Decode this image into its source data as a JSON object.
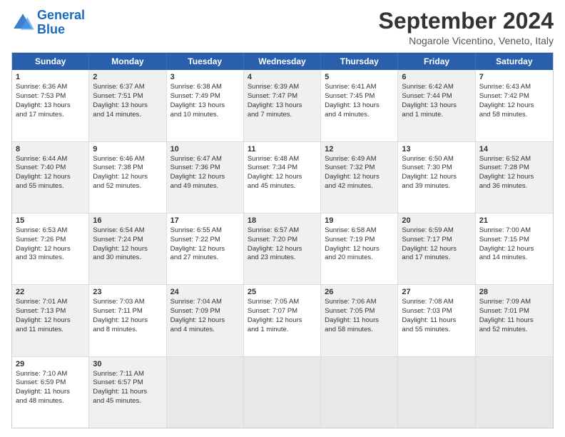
{
  "header": {
    "logo": {
      "line1": "General",
      "line2": "Blue"
    },
    "title": "September 2024",
    "location": "Nogarole Vicentino, Veneto, Italy"
  },
  "days_of_week": [
    "Sunday",
    "Monday",
    "Tuesday",
    "Wednesday",
    "Thursday",
    "Friday",
    "Saturday"
  ],
  "weeks": [
    [
      {
        "day": "1",
        "lines": [
          "Sunrise: 6:36 AM",
          "Sunset: 7:53 PM",
          "Daylight: 13 hours",
          "and 17 minutes."
        ],
        "shaded": false
      },
      {
        "day": "2",
        "lines": [
          "Sunrise: 6:37 AM",
          "Sunset: 7:51 PM",
          "Daylight: 13 hours",
          "and 14 minutes."
        ],
        "shaded": true
      },
      {
        "day": "3",
        "lines": [
          "Sunrise: 6:38 AM",
          "Sunset: 7:49 PM",
          "Daylight: 13 hours",
          "and 10 minutes."
        ],
        "shaded": false
      },
      {
        "day": "4",
        "lines": [
          "Sunrise: 6:39 AM",
          "Sunset: 7:47 PM",
          "Daylight: 13 hours",
          "and 7 minutes."
        ],
        "shaded": true
      },
      {
        "day": "5",
        "lines": [
          "Sunrise: 6:41 AM",
          "Sunset: 7:45 PM",
          "Daylight: 13 hours",
          "and 4 minutes."
        ],
        "shaded": false
      },
      {
        "day": "6",
        "lines": [
          "Sunrise: 6:42 AM",
          "Sunset: 7:44 PM",
          "Daylight: 13 hours",
          "and 1 minute."
        ],
        "shaded": true
      },
      {
        "day": "7",
        "lines": [
          "Sunrise: 6:43 AM",
          "Sunset: 7:42 PM",
          "Daylight: 12 hours",
          "and 58 minutes."
        ],
        "shaded": false
      }
    ],
    [
      {
        "day": "8",
        "lines": [
          "Sunrise: 6:44 AM",
          "Sunset: 7:40 PM",
          "Daylight: 12 hours",
          "and 55 minutes."
        ],
        "shaded": true
      },
      {
        "day": "9",
        "lines": [
          "Sunrise: 6:46 AM",
          "Sunset: 7:38 PM",
          "Daylight: 12 hours",
          "and 52 minutes."
        ],
        "shaded": false
      },
      {
        "day": "10",
        "lines": [
          "Sunrise: 6:47 AM",
          "Sunset: 7:36 PM",
          "Daylight: 12 hours",
          "and 49 minutes."
        ],
        "shaded": true
      },
      {
        "day": "11",
        "lines": [
          "Sunrise: 6:48 AM",
          "Sunset: 7:34 PM",
          "Daylight: 12 hours",
          "and 45 minutes."
        ],
        "shaded": false
      },
      {
        "day": "12",
        "lines": [
          "Sunrise: 6:49 AM",
          "Sunset: 7:32 PM",
          "Daylight: 12 hours",
          "and 42 minutes."
        ],
        "shaded": true
      },
      {
        "day": "13",
        "lines": [
          "Sunrise: 6:50 AM",
          "Sunset: 7:30 PM",
          "Daylight: 12 hours",
          "and 39 minutes."
        ],
        "shaded": false
      },
      {
        "day": "14",
        "lines": [
          "Sunrise: 6:52 AM",
          "Sunset: 7:28 PM",
          "Daylight: 12 hours",
          "and 36 minutes."
        ],
        "shaded": true
      }
    ],
    [
      {
        "day": "15",
        "lines": [
          "Sunrise: 6:53 AM",
          "Sunset: 7:26 PM",
          "Daylight: 12 hours",
          "and 33 minutes."
        ],
        "shaded": false
      },
      {
        "day": "16",
        "lines": [
          "Sunrise: 6:54 AM",
          "Sunset: 7:24 PM",
          "Daylight: 12 hours",
          "and 30 minutes."
        ],
        "shaded": true
      },
      {
        "day": "17",
        "lines": [
          "Sunrise: 6:55 AM",
          "Sunset: 7:22 PM",
          "Daylight: 12 hours",
          "and 27 minutes."
        ],
        "shaded": false
      },
      {
        "day": "18",
        "lines": [
          "Sunrise: 6:57 AM",
          "Sunset: 7:20 PM",
          "Daylight: 12 hours",
          "and 23 minutes."
        ],
        "shaded": true
      },
      {
        "day": "19",
        "lines": [
          "Sunrise: 6:58 AM",
          "Sunset: 7:19 PM",
          "Daylight: 12 hours",
          "and 20 minutes."
        ],
        "shaded": false
      },
      {
        "day": "20",
        "lines": [
          "Sunrise: 6:59 AM",
          "Sunset: 7:17 PM",
          "Daylight: 12 hours",
          "and 17 minutes."
        ],
        "shaded": true
      },
      {
        "day": "21",
        "lines": [
          "Sunrise: 7:00 AM",
          "Sunset: 7:15 PM",
          "Daylight: 12 hours",
          "and 14 minutes."
        ],
        "shaded": false
      }
    ],
    [
      {
        "day": "22",
        "lines": [
          "Sunrise: 7:01 AM",
          "Sunset: 7:13 PM",
          "Daylight: 12 hours",
          "and 11 minutes."
        ],
        "shaded": true
      },
      {
        "day": "23",
        "lines": [
          "Sunrise: 7:03 AM",
          "Sunset: 7:11 PM",
          "Daylight: 12 hours",
          "and 8 minutes."
        ],
        "shaded": false
      },
      {
        "day": "24",
        "lines": [
          "Sunrise: 7:04 AM",
          "Sunset: 7:09 PM",
          "Daylight: 12 hours",
          "and 4 minutes."
        ],
        "shaded": true
      },
      {
        "day": "25",
        "lines": [
          "Sunrise: 7:05 AM",
          "Sunset: 7:07 PM",
          "Daylight: 12 hours",
          "and 1 minute."
        ],
        "shaded": false
      },
      {
        "day": "26",
        "lines": [
          "Sunrise: 7:06 AM",
          "Sunset: 7:05 PM",
          "Daylight: 11 hours",
          "and 58 minutes."
        ],
        "shaded": true
      },
      {
        "day": "27",
        "lines": [
          "Sunrise: 7:08 AM",
          "Sunset: 7:03 PM",
          "Daylight: 11 hours",
          "and 55 minutes."
        ],
        "shaded": false
      },
      {
        "day": "28",
        "lines": [
          "Sunrise: 7:09 AM",
          "Sunset: 7:01 PM",
          "Daylight: 11 hours",
          "and 52 minutes."
        ],
        "shaded": true
      }
    ],
    [
      {
        "day": "29",
        "lines": [
          "Sunrise: 7:10 AM",
          "Sunset: 6:59 PM",
          "Daylight: 11 hours",
          "and 48 minutes."
        ],
        "shaded": false
      },
      {
        "day": "30",
        "lines": [
          "Sunrise: 7:11 AM",
          "Sunset: 6:57 PM",
          "Daylight: 11 hours",
          "and 45 minutes."
        ],
        "shaded": true
      },
      {
        "day": "",
        "lines": [],
        "shaded": false,
        "empty": true
      },
      {
        "day": "",
        "lines": [],
        "shaded": false,
        "empty": true
      },
      {
        "day": "",
        "lines": [],
        "shaded": false,
        "empty": true
      },
      {
        "day": "",
        "lines": [],
        "shaded": false,
        "empty": true
      },
      {
        "day": "",
        "lines": [],
        "shaded": false,
        "empty": true
      }
    ]
  ]
}
